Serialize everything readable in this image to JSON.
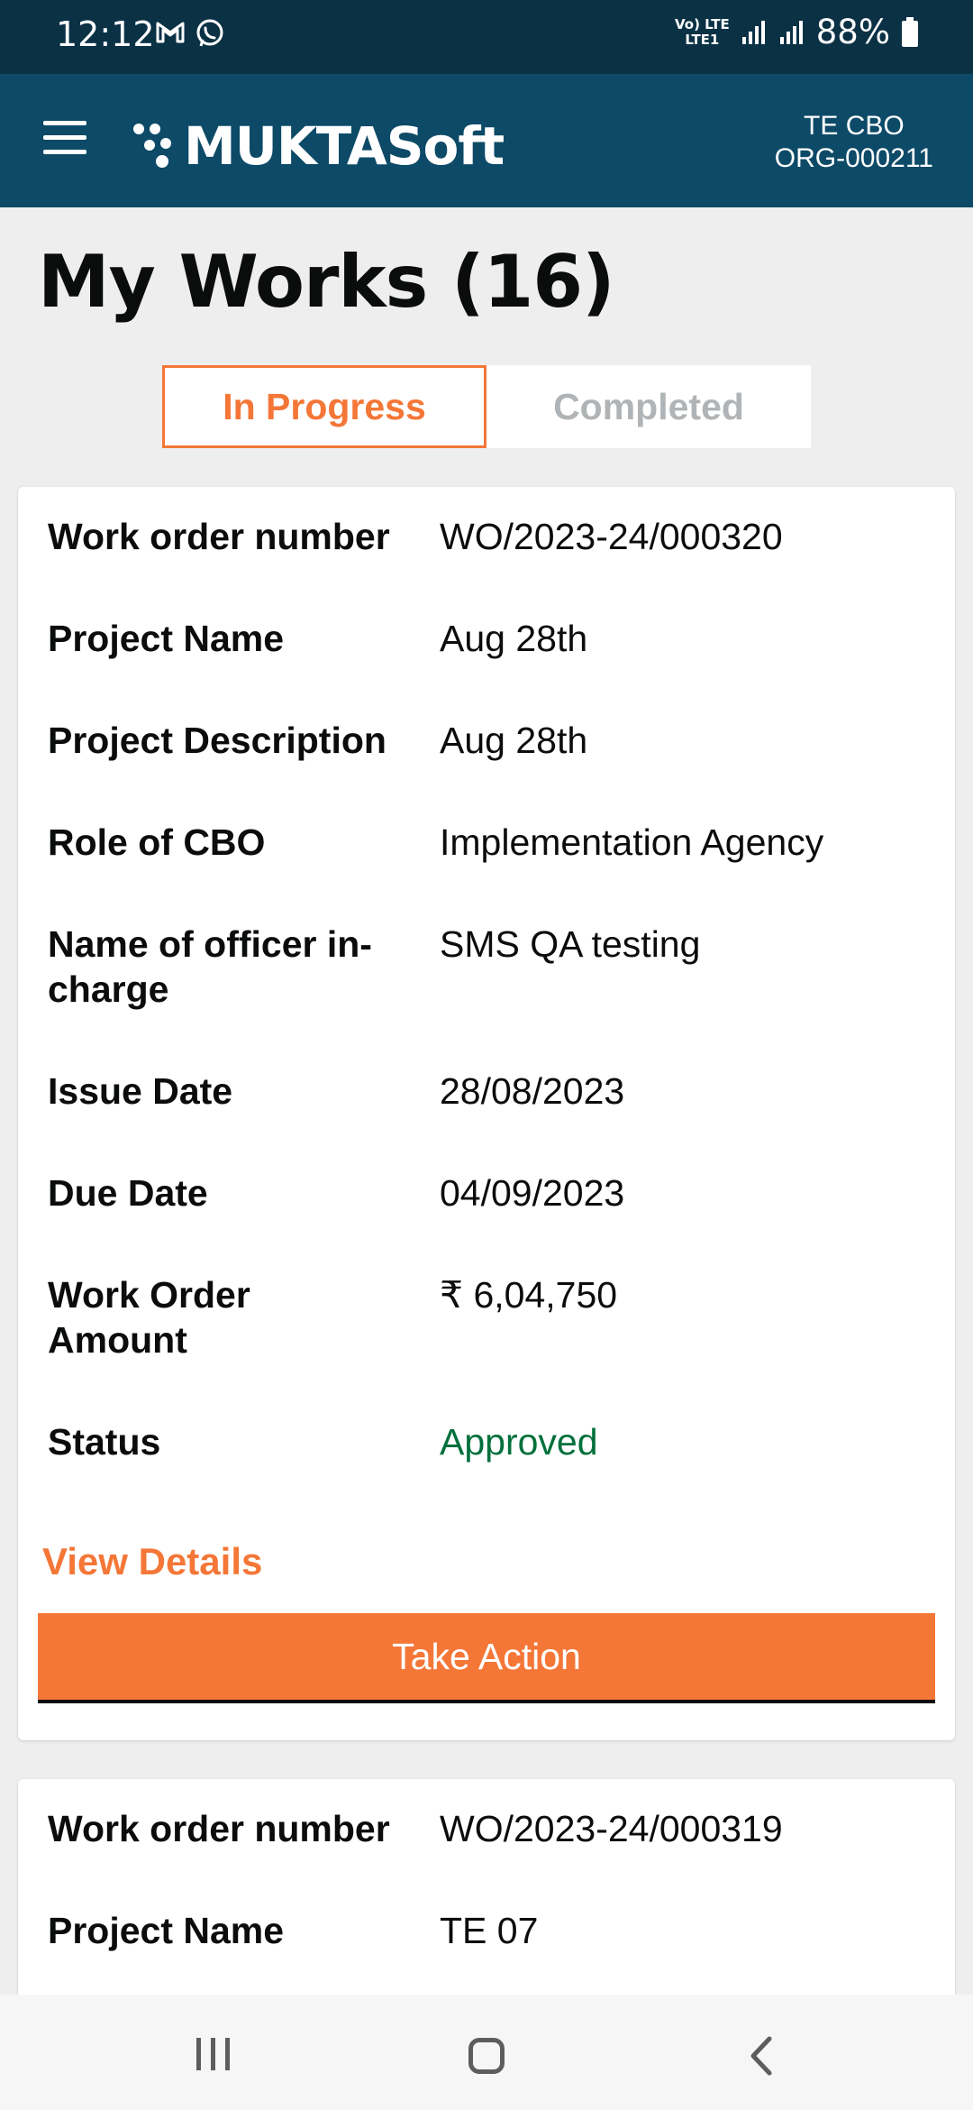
{
  "status_bar": {
    "time": "12:12",
    "left_icons": [
      "gmail-icon",
      "whatsapp-icon"
    ],
    "network_top": "Vo) LTE",
    "network_bottom": "LTE1",
    "battery": "88%"
  },
  "app_bar": {
    "brand": "MUKTASoft",
    "org_name": "TE CBO",
    "org_id": "ORG-000211"
  },
  "page": {
    "title": "My Works (16)"
  },
  "tabs": [
    {
      "label": "In Progress",
      "active": true
    },
    {
      "label": "Completed",
      "active": false
    }
  ],
  "labels": {
    "work_order_number": "Work order number",
    "project_name": "Project Name",
    "project_description": "Project Description",
    "role_of_cbo": "Role of CBO",
    "officer_in_charge": "Name of officer in-charge",
    "issue_date": "Issue Date",
    "due_date": "Due Date",
    "work_order_amount": "Work Order Amount",
    "status": "Status"
  },
  "cards": [
    {
      "work_order_number": "WO/2023-24/000320",
      "project_name": "Aug 28th",
      "project_description": "Aug 28th",
      "role_of_cbo": "Implementation Agency",
      "officer_in_charge": "SMS QA testing",
      "issue_date": "28/08/2023",
      "due_date": "04/09/2023",
      "work_order_amount": "₹ 6,04,750",
      "status": "Approved",
      "view_details": "View Details",
      "take_action": "Take Action"
    },
    {
      "work_order_number": "WO/2023-24/000319",
      "project_name": "TE 07"
    }
  ],
  "colors": {
    "status_bar": "#0b3145",
    "app_bar": "#0d4a67",
    "accent": "#f47738",
    "approved": "#00703c"
  }
}
